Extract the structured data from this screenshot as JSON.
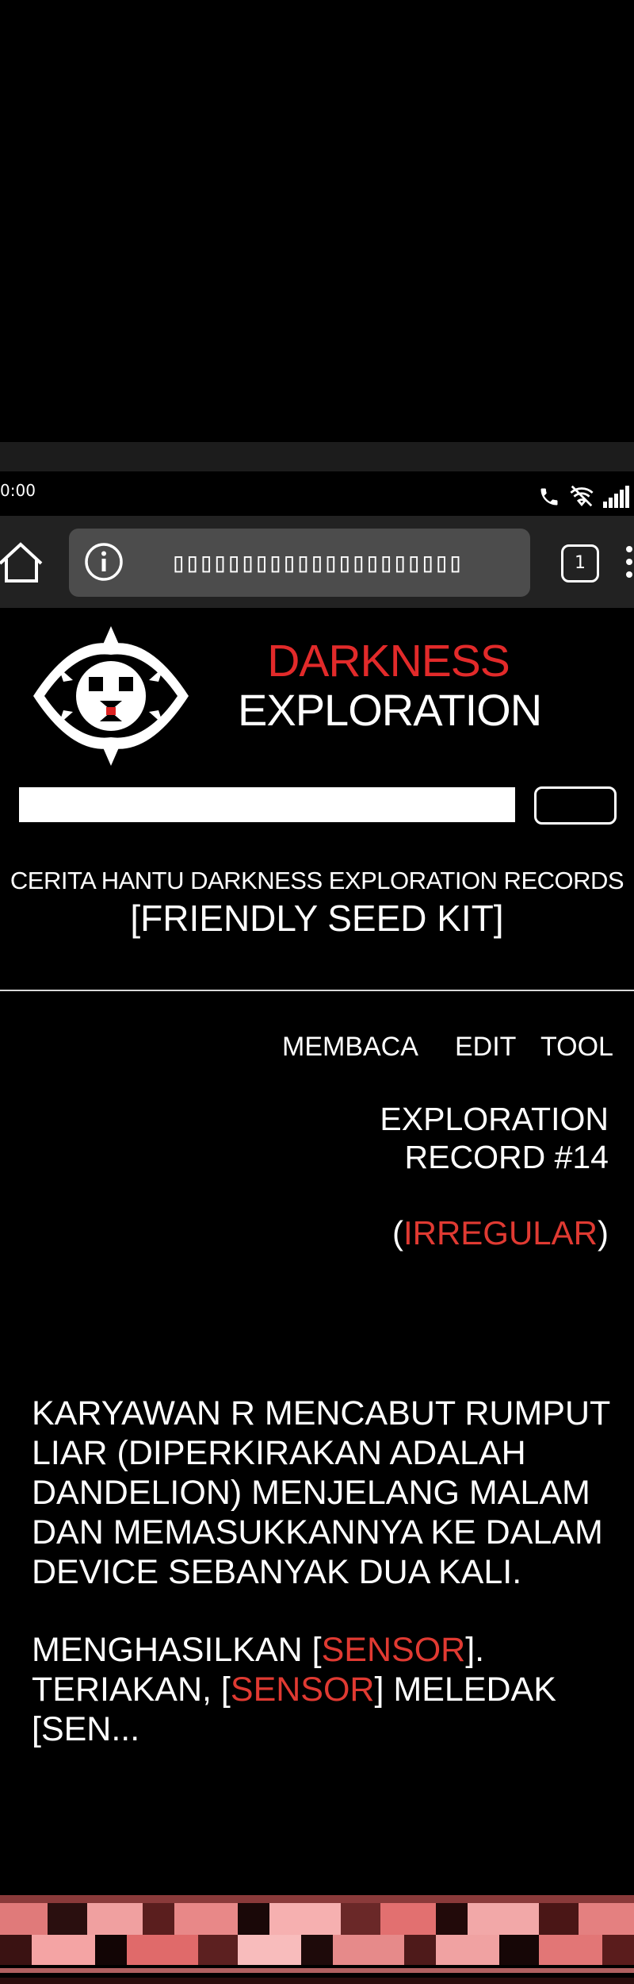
{
  "status_bar": {
    "time": "0:00",
    "icons": [
      "phone-icon",
      "wifi-off-icon",
      "signal-icon"
    ]
  },
  "browser": {
    "url": "▯▯▯▯▯▯▯▯▯▯▯▯▯▯▯▯▯▯▯▯▯",
    "tab_count": "1",
    "icons": [
      "home-icon",
      "info-icon",
      "tabs-icon",
      "menu-icon"
    ]
  },
  "header": {
    "title_line1": "DARKNESS",
    "title_line2": "EXPLORATION",
    "logo_icon": "eye-creature-icon"
  },
  "search": {
    "value": "",
    "button_label": ""
  },
  "subtitle": {
    "line1": "CERITA HANTU DARKNESS EXPLORATION RECORDS",
    "line2": "[FRIENDLY SEED KIT]"
  },
  "nav": {
    "read": "MEMBACA",
    "edit": "EDIT",
    "tool": "TOOL"
  },
  "record": {
    "title_line1": "EXPLORATION",
    "title_line2": "RECORD #14",
    "class_open": "(",
    "class_label": "IRREGULAR",
    "class_close": ")"
  },
  "body": {
    "para1": "KARYAWAN R MENCABUT RUMPUT LIAR (DIPERKIRAKAN ADALAH DANDELION) MENJELANG MALAM DAN MEMASUKKANNYA KE DALAM DEVICE SEBANYAK DUA KALI.",
    "para2_a": "MENGHASILKAN [",
    "para2_b": "SENSOR",
    "para2_c": "]. TERIAKAN, [",
    "para2_d": "SENSOR",
    "para2_e": "] MELEDAK [SEN..."
  },
  "colors": {
    "accent_red": "#e22a2a",
    "background": "#000000",
    "url_box": "#4c4c4c"
  }
}
